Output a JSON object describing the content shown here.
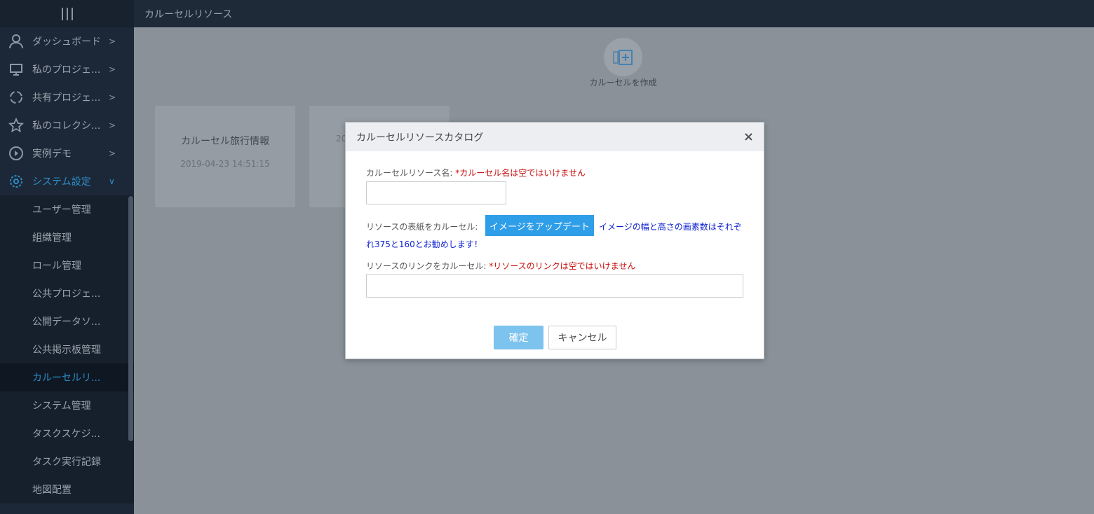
{
  "topbar": {
    "title": "カルーセルリソース"
  },
  "sidebar": {
    "items": [
      {
        "label": "ダッシュボード",
        "icon": "user-icon",
        "arrow": ">"
      },
      {
        "label": "私のプロジェ...",
        "icon": "monitor-icon",
        "arrow": ">"
      },
      {
        "label": "共有プロジェ...",
        "icon": "share-circle-icon",
        "arrow": ">"
      },
      {
        "label": "私のコレクシ...",
        "icon": "star-icon",
        "arrow": ">"
      },
      {
        "label": "実例デモ",
        "icon": "play-icon",
        "arrow": ">"
      },
      {
        "label": "システム設定",
        "icon": "gear-icon",
        "arrow": "∨"
      }
    ],
    "sub_items": [
      "ユーザー管理",
      "組織管理",
      "ロール管理",
      "公共プロジェ...",
      "公開データソ...",
      "公共掲示板管理",
      "カルーセルリ...",
      "システム管理",
      "タスクスケジ...",
      "タスク実行記録",
      "地図配置"
    ]
  },
  "main": {
    "create_label": "カルーセルを作成",
    "cards": [
      {
        "title": "カルーセル旅行情報",
        "date": "2019-04-23 14:51:15"
      },
      {
        "title": "",
        "date": "20"
      }
    ]
  },
  "dialog": {
    "title": "カルーセルリソースカタログ",
    "close": "×",
    "name_label": "カルーセルリソース名:",
    "name_error": "*カルーセル名は空ではいけません",
    "name_value": "",
    "cover_label": "リソースの表紙をカルーセル:",
    "upload_label": "イメージをアップデート",
    "cover_hint_1": "イメージの幅と高さの画素数はそれぞ",
    "cover_hint_2": "れ375と160とお勧めします！",
    "link_label": "リソースのリンクをカルーセル:",
    "link_error": "*リソースのリンクは空ではいけません",
    "link_value": "",
    "ok_label": "確定",
    "cancel_label": "キャンセル"
  }
}
